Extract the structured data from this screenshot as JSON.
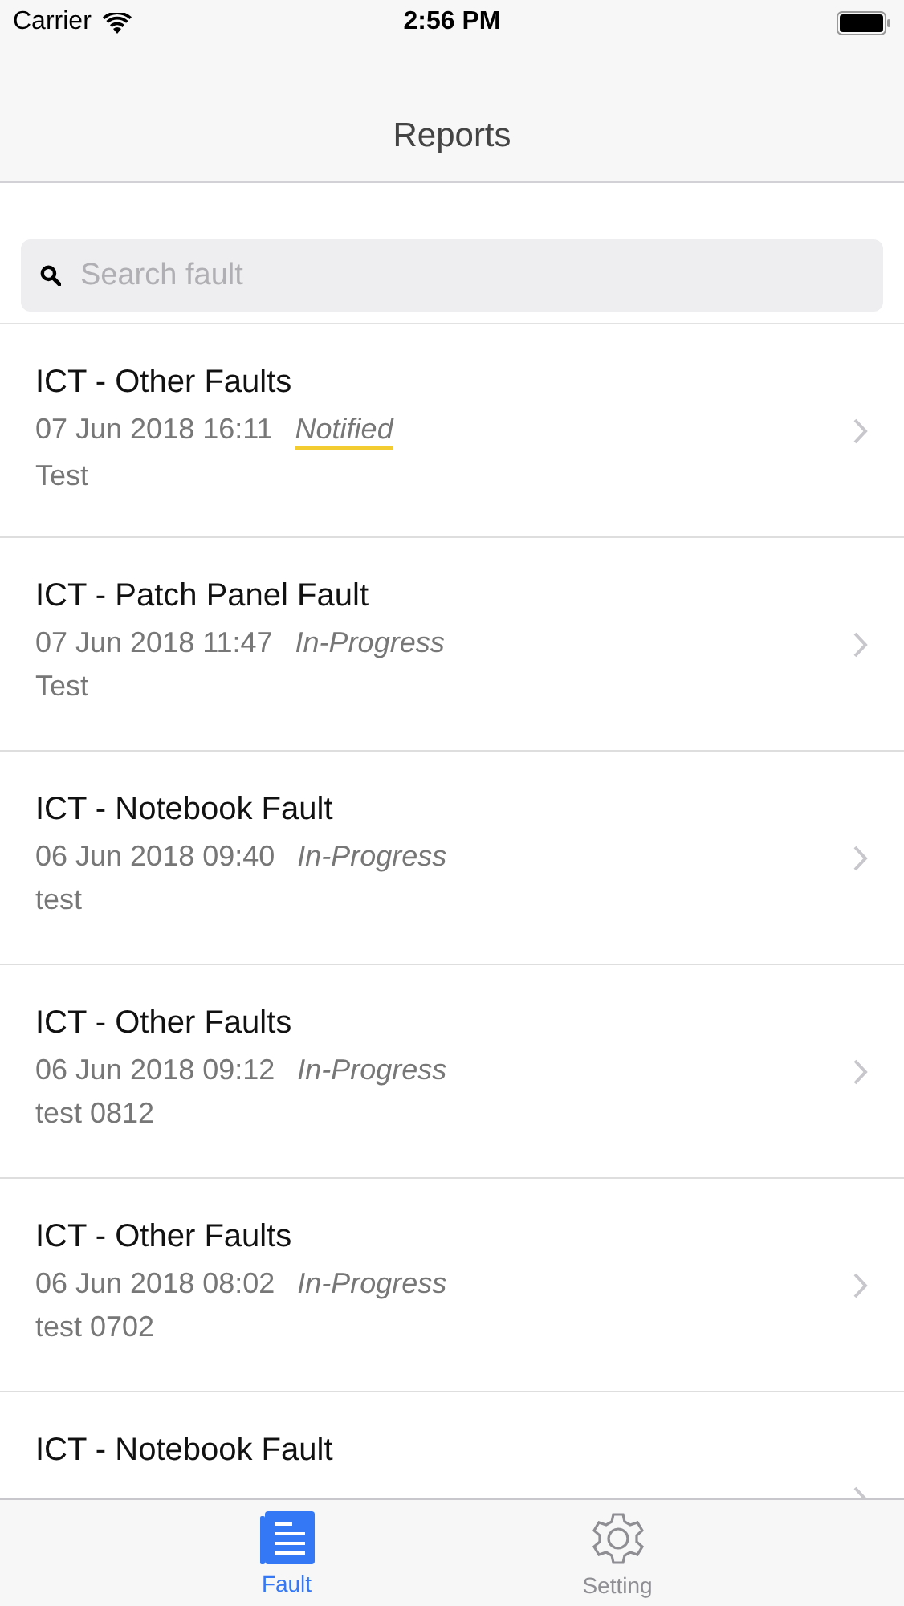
{
  "status_bar": {
    "carrier": "Carrier",
    "time": "2:56 PM"
  },
  "nav": {
    "title": "Reports"
  },
  "search": {
    "placeholder": "Search fault"
  },
  "reports": [
    {
      "title": "ICT - Other Faults",
      "date": "07 Jun 2018 16:11",
      "status": "Notified",
      "underlined": true,
      "note": "Test"
    },
    {
      "title": "ICT - Patch Panel Fault",
      "date": "07 Jun 2018 11:47",
      "status": "In-Progress",
      "underlined": false,
      "note": "Test"
    },
    {
      "title": "ICT - Notebook Fault",
      "date": "06 Jun 2018 09:40",
      "status": "In-Progress",
      "underlined": false,
      "note": "test"
    },
    {
      "title": "ICT - Other Faults",
      "date": "06 Jun 2018 09:12",
      "status": "In-Progress",
      "underlined": false,
      "note": "test 0812"
    },
    {
      "title": "ICT - Other Faults",
      "date": "06 Jun 2018 08:02",
      "status": "In-Progress",
      "underlined": false,
      "note": "test 0702"
    },
    {
      "title": "ICT - Notebook Fault"
    }
  ],
  "tabs": [
    {
      "label": "Fault",
      "kind": "fault",
      "selected": true
    },
    {
      "label": "Setting",
      "kind": "setting",
      "selected": false
    }
  ]
}
